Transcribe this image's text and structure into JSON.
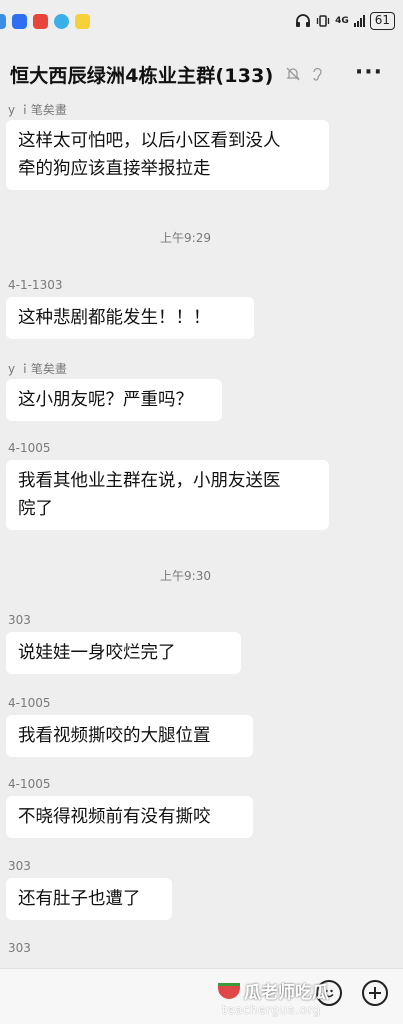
{
  "status_bar": {
    "network": "4G",
    "battery": "61"
  },
  "header": {
    "title": "恒大西辰绿洲4栋业主群(133)",
    "more": "···"
  },
  "messages": [
    {
      "sender": "y ｉ笔矣畫",
      "text": "这样太可怕吧，以后小区看到没人\n牵的狗应该直接举报拉走"
    },
    {
      "timestamp": "上午9:29"
    },
    {
      "sender": "4-1-1303",
      "text": "这种悲剧都能发生！！！"
    },
    {
      "sender": "y ｉ笔矣畫",
      "text": "这小朋友呢？严重吗？"
    },
    {
      "sender": "4-1005",
      "text": "我看其他业主群在说，小朋友送医\n院了"
    },
    {
      "timestamp": "上午9:30"
    },
    {
      "sender": "303",
      "text": "说娃娃一身咬烂完了"
    },
    {
      "sender": "4-1005",
      "text": "我看视频撕咬的大腿位置"
    },
    {
      "sender": "4-1005",
      "text": "不晓得视频前有没有撕咬"
    },
    {
      "sender": "303",
      "text": "还有肚子也遭了"
    },
    {
      "sender": "303"
    }
  ],
  "watermark": {
    "brand": "瓜老师吃瓜",
    "url": "teachergua.org"
  }
}
